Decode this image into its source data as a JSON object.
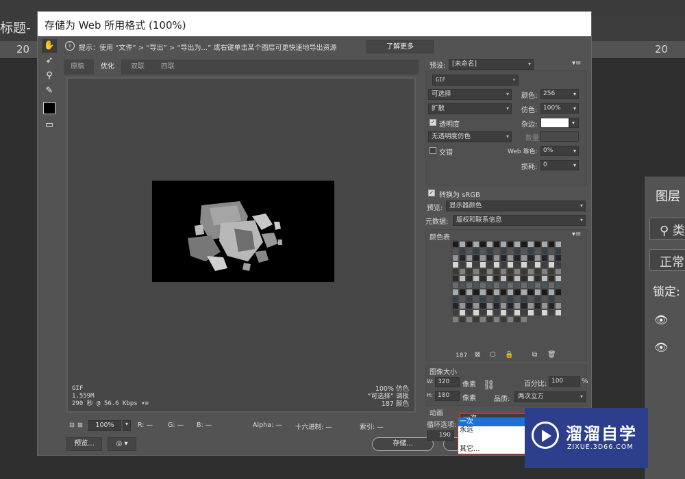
{
  "background": {
    "doc_title": "标题-",
    "ruler_left": "20",
    "ruler_right": "20",
    "layers": {
      "title": "图层",
      "search": "类",
      "blend": "正常",
      "lock": "锁定:"
    }
  },
  "dialog": {
    "title": "存储为 Web 所用格式 (100%)",
    "hint": "提示：使用 “文件” > “导出” > “导出为...” 或右键单击某个图层可更快速地导出资源",
    "hint_button": "了解更多",
    "tabs": [
      "原稿",
      "优化",
      "双联",
      "四联"
    ],
    "preview_info": {
      "left": [
        "GIF",
        "1.559M",
        "290 秒 @ 56.6 Kbps"
      ],
      "right": [
        "100% 仿色",
        "“可选择” 调板",
        "187 颜色"
      ]
    },
    "statusbar": {
      "zoom": "100%",
      "r": "R: —",
      "g": "G: —",
      "b": "B: —",
      "alpha": "Alpha: —",
      "hex": "十六进制: —",
      "index": "索引: —"
    },
    "buttons": {
      "preview": "预览...",
      "save": "存储..."
    },
    "right_panel": {
      "preset_label": "预设:",
      "preset_value": "[未命名]",
      "format": "GIF",
      "reduction": "可选择",
      "colors_label": "颜色:",
      "colors_value": "256",
      "dither_algo": "扩散",
      "dither_label": "仿色:",
      "dither_value": "100%",
      "transparency_label": "透明度",
      "matte_label": "杂边:",
      "trans_dither": "无透明度仿色",
      "amount_label": "数量",
      "interlaced_label": "交错",
      "websnap_label": "Web 靠色:",
      "websnap_value": "0%",
      "lossy_label": "损耗:",
      "lossy_value": "0",
      "srgb_label": "转换为 sRGB",
      "preview_label": "预览:",
      "preview_value": "显示器颜色",
      "metadata_label": "元数据:",
      "metadata_value": "版权和联系信息",
      "palette_label": "颜色表",
      "palette_count": "187",
      "image_size_label": "图像大小",
      "w_label": "W:",
      "w_value": "320",
      "h_label": "H:",
      "h_value": "180",
      "px": "像素",
      "percent_label": "百分比:",
      "percent_value": "100",
      "pct": "%",
      "quality_label": "品质:",
      "quality_value": "两次立方",
      "animation_label": "动画",
      "loop_label": "循环选项:",
      "loop_value": "一次",
      "frame": "190"
    },
    "loop_dropdown": [
      "一次",
      "永远",
      "其它..."
    ]
  },
  "watermark": {
    "cn": "溜溜自学",
    "en": "ZIXUE.3D66.COM"
  }
}
